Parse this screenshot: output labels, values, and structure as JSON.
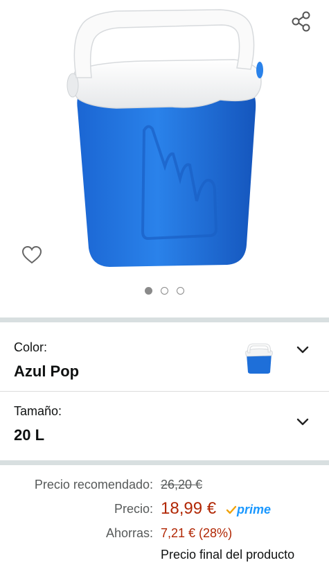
{
  "product": {
    "image_icon": "cooler-box-image",
    "share_icon": "share-icon",
    "wishlist_icon": "heart-outline-icon",
    "carousel": {
      "count": 3,
      "active": 0
    }
  },
  "variants": {
    "color": {
      "label": "Color:",
      "value": "Azul Pop",
      "swatch_icon": "cooler-thumbnail"
    },
    "size": {
      "label": "Tamaño:",
      "value": "20 L"
    }
  },
  "pricing": {
    "recommended_label": "Precio recomendado:",
    "recommended_value": "26,20 €",
    "price_label": "Precio:",
    "price_value": "18,99 €",
    "prime_label": "prime",
    "savings_label": "Ahorras:",
    "savings_value": "7,21 € (28%)",
    "final_note": "Precio final del producto"
  },
  "colors": {
    "price_red": "#b12704",
    "prime_blue": "#1a98ff",
    "cooler_blue": "#1e6fd9",
    "divider_gray": "#d8dfe0"
  }
}
